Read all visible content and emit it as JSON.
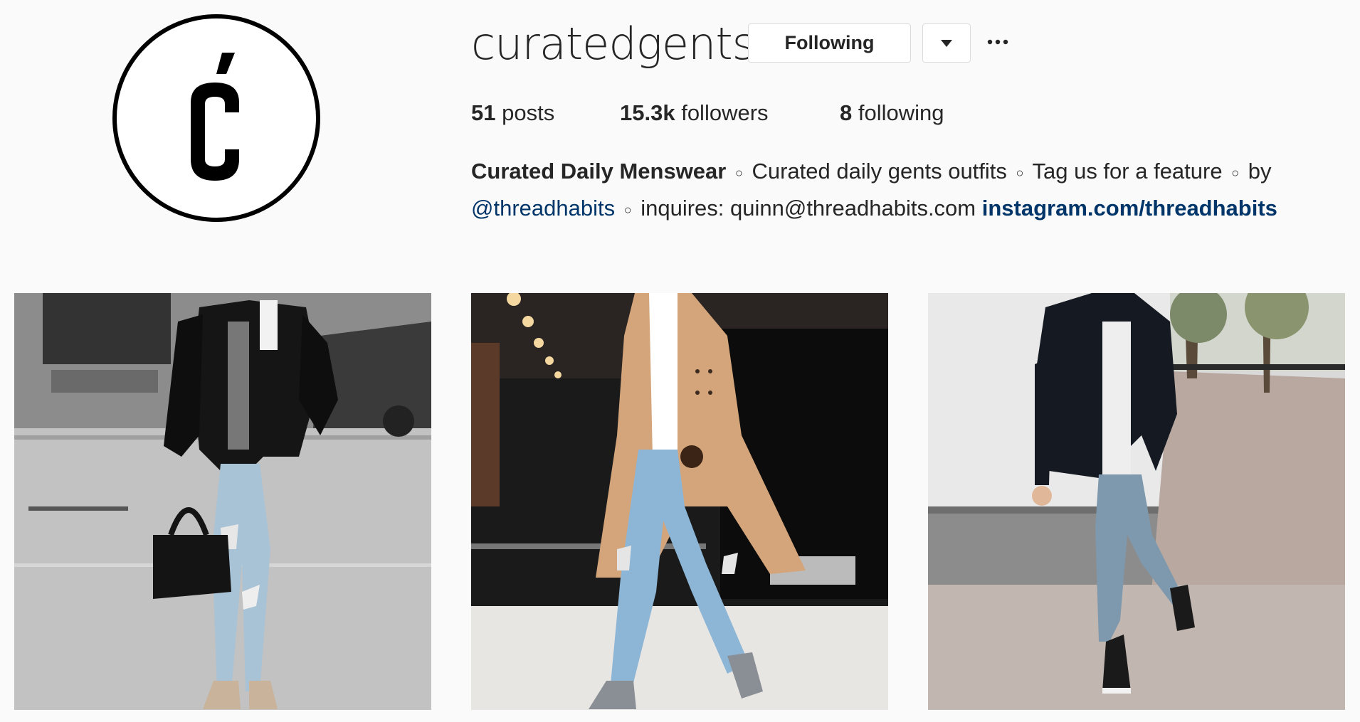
{
  "profile": {
    "username": "curatedgents",
    "avatar_letter": "Ć",
    "follow_button_label": "Following",
    "dropdown_icon": "caret-down-icon",
    "more_icon": "ellipsis-icon"
  },
  "stats": {
    "posts_count": "51",
    "posts_label": "posts",
    "followers_count": "15.3k",
    "followers_label": "followers",
    "following_count": "8",
    "following_label": "following"
  },
  "bio": {
    "name": "Curated Daily Menswear",
    "separator": "○",
    "part1": "Curated daily gents outfits",
    "part2": "Tag us for a feature",
    "part3": "by",
    "mention": "@threadhabits",
    "inquiries": "inquires: quinn@threadhabits.com",
    "website": "instagram.com/threadhabits"
  },
  "posts": [
    {
      "subject": "black varsity jacket, ripped light jeans, duffel bag"
    },
    {
      "subject": "camel overcoat, ripped light jeans, grey chelsea boots"
    },
    {
      "subject": "black bomber jacket, white tee, jeans, vans sneakers"
    }
  ],
  "colors": {
    "link": "#003569",
    "text": "#262626",
    "background": "#fafafa",
    "border": "#dbdbdb"
  }
}
